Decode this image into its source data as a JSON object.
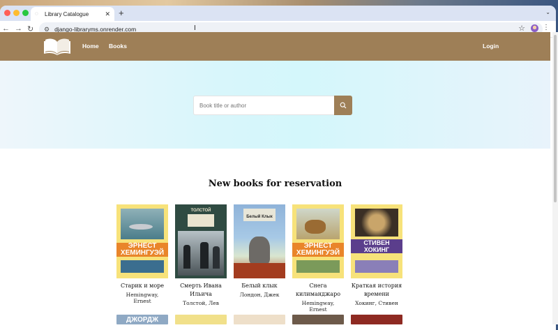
{
  "browser": {
    "tab_title": "Library Catalogue",
    "url": "django-libraryms.onrender.com"
  },
  "nav": {
    "home": "Home",
    "books": "Books",
    "login": "Login"
  },
  "search": {
    "placeholder": "Book title or author"
  },
  "section_title": "New books for reservation",
  "books": [
    {
      "title": "Старик и море",
      "author": "Hemingway, Ernest",
      "cover_text": "ЭРНЕСТ ХЕМИНГУЭЙ",
      "cover_color": "#f7e27a"
    },
    {
      "title": "Смерть Ивана Ильича",
      "author": "Толстой, Лев",
      "cover_text": "ТОЛСТОЙ",
      "cover_color": "#2f4b42"
    },
    {
      "title": "Белый клык",
      "author": "Лондон, Джек",
      "cover_text": "Белый Клык",
      "cover_color": "#8fb3d9"
    },
    {
      "title": "Снега килиманджаро",
      "author": "Hemingway, Ernest",
      "cover_text": "ЭРНЕСТ ХЕМИНГУЭЙ",
      "cover_color": "#f7e27a"
    },
    {
      "title": "Краткая история времени",
      "author": "Хокинг, Стивен",
      "cover_text": "СТИВЕН ХОКИНГ",
      "cover_color": "#f7e27a"
    }
  ],
  "row2_cover_text": "ДЖОРДЖ"
}
